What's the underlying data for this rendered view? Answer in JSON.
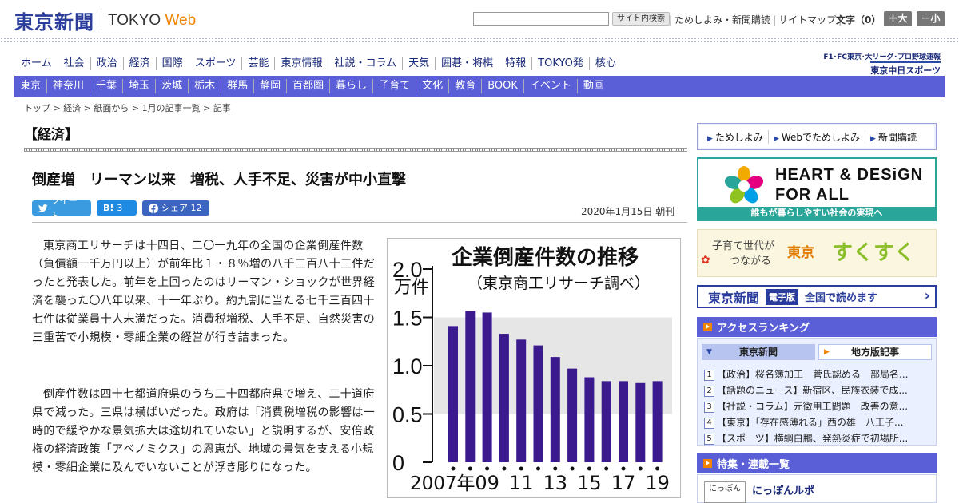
{
  "header": {
    "logo_jp": "東京新聞",
    "logo_en": "TOKYO",
    "logo_web": "Web",
    "search_button": "サイト内検索",
    "top_links": [
      "ためしよみ・新聞購読",
      "サイトマップ"
    ],
    "font_size_label": "文字（0）",
    "font_bigger": "＋大",
    "font_smaller": "－小"
  },
  "nav_main": [
    "ホーム",
    "社会",
    "政治",
    "経済",
    "国際",
    "スポーツ",
    "芸能",
    "東京情報",
    "社説・コラム",
    "天気",
    "囲碁・将棋",
    "特報",
    "TOKYO発",
    "核心"
  ],
  "sponsor": {
    "line1": "F1･FC東京･大リーグ･プロ野球速報",
    "line2": "東京中日スポーツ"
  },
  "nav_regional": [
    "東京",
    "神奈川",
    "千葉",
    "埼玉",
    "茨城",
    "栃木",
    "群馬",
    "静岡",
    "首都圏",
    "暮らし",
    "子育て",
    "文化",
    "教育",
    "BOOK",
    "イベント",
    "動画"
  ],
  "breadcrumb": "トップ > 経済 > 紙面から > 1月の記事一覧 > 記事",
  "article": {
    "section": "【経済】",
    "headline": "倒産増　リーマン以来　増税、人手不足、災害が中小直撃",
    "share_tweet": "ツイート",
    "share_hatena_icon": "B!",
    "share_hatena_count": "3",
    "share_facebook": "シェア 12",
    "date": "2020年1月15日 朝刊",
    "paragraph1": "東京商工リサーチは十四日、二〇一九年の全国の企業倒産件数（負債額一千万円以上）が前年比１・８％増の八千三百八十三件だったと発表した。前年を上回ったのはリーマン・ショックが世界経済を襲った〇八年以来、十一年ぶり。約九割に当たる七千三百四十七件は従業員十人未満だった。消費税増税、人手不足、自然災害の三重苦で小規模・零細企業の経営が行き詰まった。",
    "paragraph2": "倒産件数は四十七都道府県のうち二十四都府県で増え、二十道府県で減った。三県は横ばいだった。政府は「消費税増税の影響は一時的で緩やかな景気拡大は途切れていない」と説明するが、安倍政権の経済政策「アベノミクス」の恩恵が、地域の景気を支える小規模・零細企業に及んでいないことが浮き彫りになった。"
  },
  "chart_data": {
    "type": "bar",
    "title": "企業倒産件数の推移",
    "subtitle": "（東京商工リサーチ調べ）",
    "ylabel": "万件",
    "ylim": [
      0,
      2.0
    ],
    "yticks": [
      "0",
      "0.5",
      "1.0",
      "1.5",
      "2.0"
    ],
    "x": [
      2007,
      2008,
      2009,
      2010,
      2011,
      2012,
      2013,
      2014,
      2015,
      2016,
      2017,
      2018,
      2019
    ],
    "xtick_labels": [
      "2007年",
      "09",
      "11",
      "13",
      "15",
      "17",
      "19"
    ],
    "values": [
      1.41,
      1.57,
      1.55,
      1.33,
      1.27,
      1.21,
      1.09,
      0.97,
      0.88,
      0.84,
      0.84,
      0.82,
      0.84
    ],
    "bar_color": "#3a1a8c"
  },
  "sidebar": {
    "quick_links": [
      "ためしよみ",
      "Webでためしよみ",
      "新聞購読"
    ],
    "hd_line1": "HEART & DESiGN",
    "hd_line2": "FOR ALL",
    "hd_caption": "誰もが暮らしやすい社会の実現へ",
    "suku_line1": "子育て世代が",
    "suku_line2": "つながる",
    "suku_tokyo": "東京",
    "suku_name": "すくすく",
    "denshi_logo": "東京新聞",
    "denshi_badge": "電子版",
    "denshi_text": "全国で読めます",
    "ranking_title": "アクセスランキング",
    "ranking_tab1": "東京新聞",
    "ranking_tab2": "地方版記事",
    "ranking": [
      {
        "num": "1",
        "text": "【政治】桜名簿加工　菅氏認める　部局名..."
      },
      {
        "num": "2",
        "text": "【話題のニュース】新宿区、民族衣装で成..."
      },
      {
        "num": "3",
        "text": "【社説・コラム】元徴用工問題　改善の意..."
      },
      {
        "num": "4",
        "text": "【東京】「存在感薄れる」西の雄　八王子..."
      },
      {
        "num": "5",
        "text": "【スポーツ】横綱白鵬、発熱炎症で初場所..."
      }
    ],
    "tokushu_title": "特集・連載一覧",
    "nippon_thumb": "にっぽん",
    "nippon_title": "にっぽんルポ"
  }
}
